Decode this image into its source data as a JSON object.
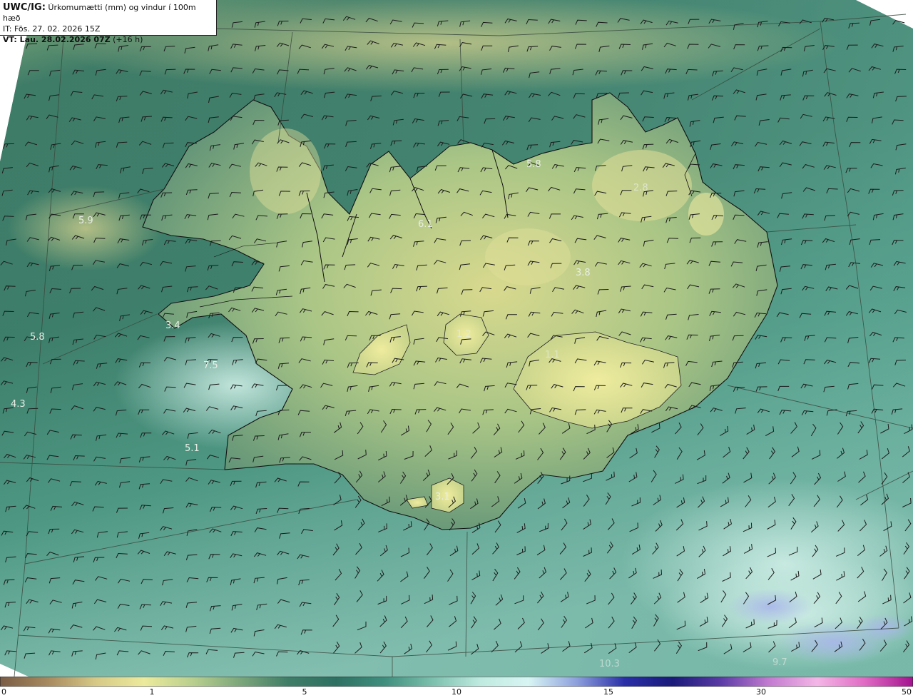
{
  "title": {
    "model": "UWC/IG:",
    "description": "Úrkomumætti (mm) og vindur í 100m hæð",
    "init_time": "IT: Fös. 27. 02. 2026 15Z",
    "valid_prefix": "VT: Lau. 28.02.2026 07Z",
    "valid_suffix": "(+16 h)"
  },
  "value_labels": [
    {
      "text": "5.8"
    },
    {
      "text": "2.8"
    },
    {
      "text": "6.1"
    },
    {
      "text": "3.8"
    },
    {
      "text": "5.9"
    },
    {
      "text": "3.4"
    },
    {
      "text": "5.8"
    },
    {
      "text": "7.5"
    },
    {
      "text": "4.3"
    },
    {
      "text": "5.1"
    },
    {
      "text": "1.1"
    },
    {
      "text": "1.2"
    },
    {
      "text": "3.1"
    },
    {
      "text": "10.3"
    },
    {
      "text": "9.7"
    }
  ],
  "colorbar": {
    "ticks": [
      "0",
      "1",
      "5",
      "10",
      "15",
      "30",
      "50"
    ],
    "colors": [
      "#7a5d44",
      "#a88a5f",
      "#d6c986",
      "#ecea9c",
      "#b9cf8e",
      "#7ca77b",
      "#3f7d67",
      "#2e7163",
      "#3f8f7e",
      "#7cc0ad",
      "#bfeadf",
      "#d8f5f4",
      "#8d9fdc",
      "#2a2fa8",
      "#1a1a7a",
      "#5a3aa6",
      "#c27ad0",
      "#f4b6e6",
      "#e06ac4",
      "#a4128f"
    ]
  },
  "colors": {
    "land_high": "#e6e59a",
    "land_mid": "#9fbf83",
    "sea_north": "#3f7a66",
    "sea_south": "#a9ddd2",
    "coast": "#111111"
  }
}
